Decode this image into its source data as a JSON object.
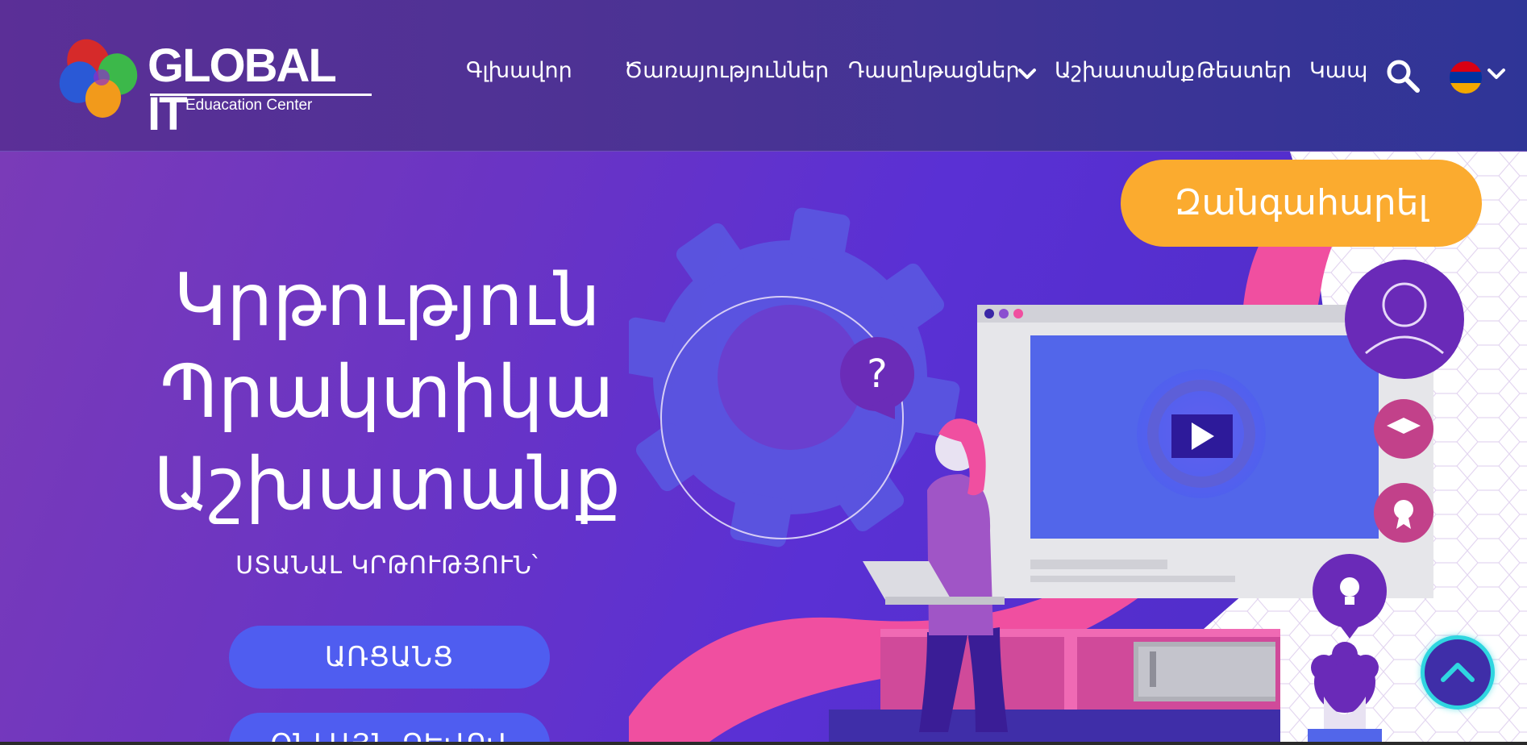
{
  "logo": {
    "title": "GLOBAL IT",
    "subtitle": "Eduacation Center"
  },
  "nav": {
    "items": [
      {
        "label": "Գլխավոր"
      },
      {
        "label": "Ծառայություններ"
      },
      {
        "label": "Դասընթացներ"
      },
      {
        "label": "Աշխատանք"
      },
      {
        "label": "Թեստեր"
      },
      {
        "label": "Կապ"
      }
    ],
    "search_icon": "search-icon",
    "language_flag": "armenian-flag-icon"
  },
  "hero": {
    "title_lines": [
      "Կրթություն",
      "Պրակտիկա",
      "Աշխատանք"
    ],
    "subtitle": "ՍՏԱՆԱԼ ԿՐԹՈՒԹՅՈՒՆ՝",
    "buttons": [
      "ԱՌՑԱՆՑ",
      "ՕՆԼԱՅՆ ՁԵՎՈՎ"
    ],
    "call_button": "Զանգահարել"
  },
  "colors": {
    "header_start": "#5b2f97",
    "header_end": "#2f3597",
    "hero_accent": "#4f5df0",
    "call_accent": "#fbab2f",
    "pink": "#f04fa0"
  }
}
